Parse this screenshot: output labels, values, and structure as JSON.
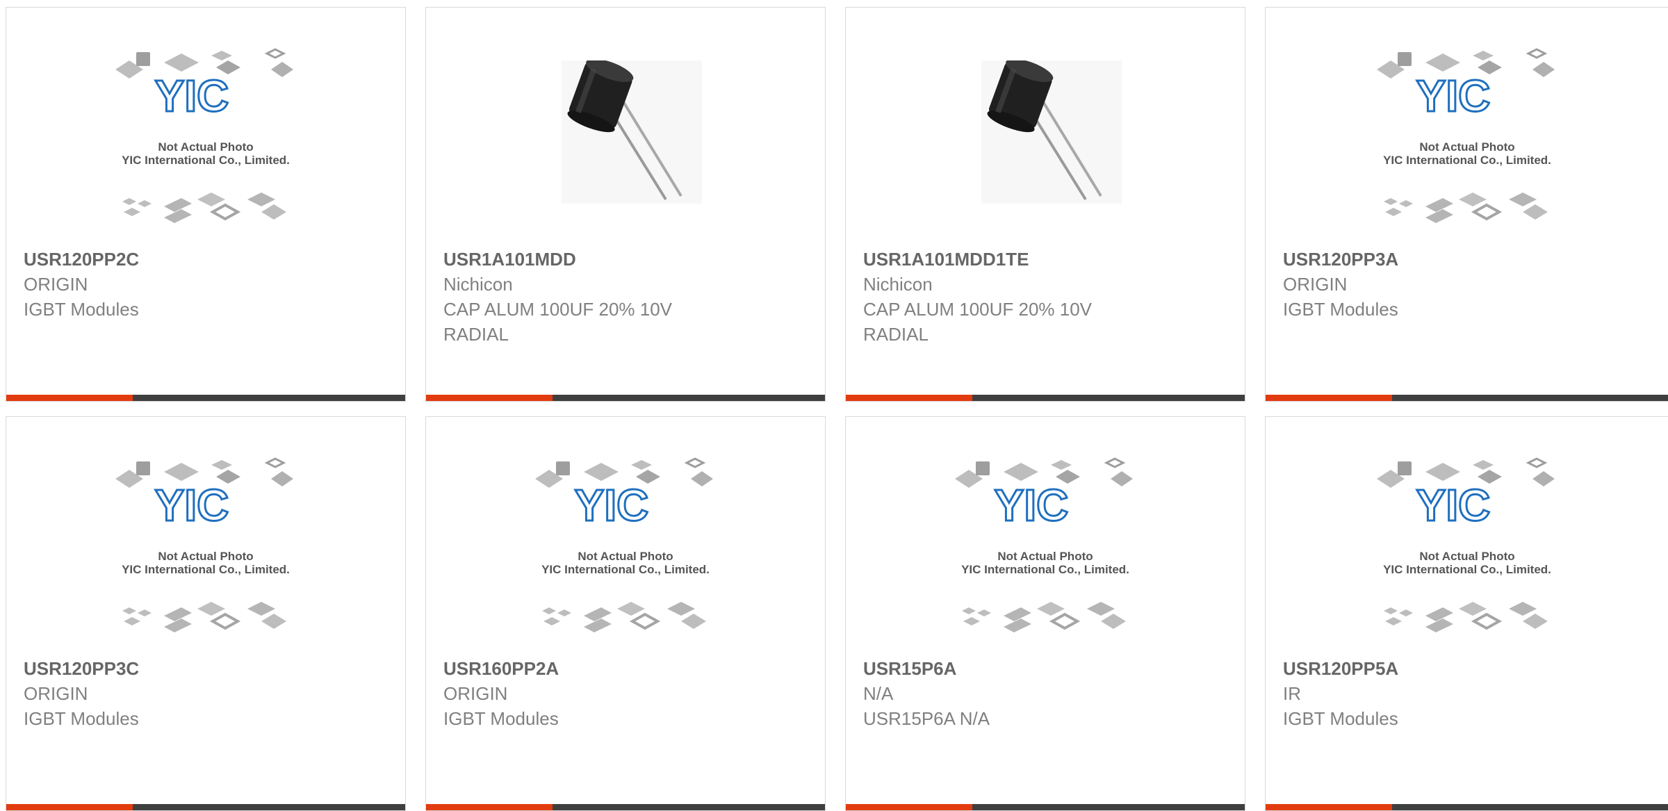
{
  "colors": {
    "accent": "#e23b10",
    "bar": "#3f3f3f",
    "logo": "#1f6fbf"
  },
  "placeholder": {
    "line1": "Not Actual Photo",
    "line2": "YIC International Co., Limited."
  },
  "products": [
    {
      "part_number": "USR120PP2C",
      "manufacturer": "ORIGIN",
      "description": "IGBT Modules",
      "image": "placeholder"
    },
    {
      "part_number": "USR1A101MDD",
      "manufacturer": "Nichicon",
      "description": "CAP ALUM 100UF 20% 10V RADIAL",
      "image": "capacitor"
    },
    {
      "part_number": "USR1A101MDD1TE",
      "manufacturer": "Nichicon",
      "description": "CAP ALUM 100UF 20% 10V RADIAL",
      "image": "capacitor"
    },
    {
      "part_number": "USR120PP3A",
      "manufacturer": "ORIGIN",
      "description": "IGBT Modules",
      "image": "placeholder"
    },
    {
      "part_number": "USR120PP3C",
      "manufacturer": "ORIGIN",
      "description": "IGBT Modules",
      "image": "placeholder"
    },
    {
      "part_number": "USR160PP2A",
      "manufacturer": "ORIGIN",
      "description": "IGBT Modules",
      "image": "placeholder"
    },
    {
      "part_number": "USR15P6A",
      "manufacturer": "N/A",
      "description": "USR15P6A N/A",
      "image": "placeholder"
    },
    {
      "part_number": "USR120PP5A",
      "manufacturer": "IR",
      "description": "IGBT Modules",
      "image": "placeholder"
    }
  ]
}
